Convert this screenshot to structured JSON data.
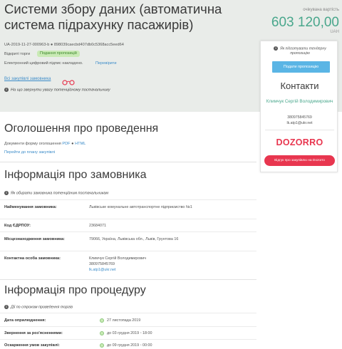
{
  "header": {
    "title": "Системи збору даних (автоматична система підрахунку пасажирів)",
    "price_label": "очікувана вартість",
    "price": "603 120,00",
    "currency": "UAH",
    "tender_id": "UA-2019-11-27-000963-b ● 898039caecbd407db0c5368acc5eed64",
    "tender_type": "Відкриті торги",
    "status_badge": "Подання пропозицій",
    "signature_text": "Електронний цифровий підпис накладено.",
    "signature_link": "Перевірити",
    "all_procurements_link": "Всі закупівлі замовника",
    "attention_hint": "На що звернути увагу потенційному постачальнику"
  },
  "panel": {
    "hint": "Як підготувати тендерну пропозицію",
    "offer_button": "Подати пропозицію",
    "contacts_title": "Контакти",
    "contact_name": "Климчук Сергій Володимирович",
    "phone": "380975845769",
    "email": "lk.atp1@ukr.net",
    "dozorro_logo": "DOZORRO",
    "review_button": "Відгук про закупівлю на Dozorro"
  },
  "announcement": {
    "title": "Оголошення про проведення",
    "docs_prefix": "Документи форму оголошення",
    "pdf": "PDF",
    "sep": "●",
    "html": "HTML",
    "plan_link": "Перейти до плану закупівлі"
  },
  "customer": {
    "title": "Інформація про замовника",
    "hint": "Як обирати замовника потенційним постачальникам",
    "rows": [
      {
        "label": "Найменування замовника:",
        "value": "Львівське комунальне автотранспортне підприємство №1"
      },
      {
        "label": "Код ЄДРПОУ:",
        "value": "23684071"
      },
      {
        "label": "Місцезнаходження замовника:",
        "value": "79066, Україна, Львівська обл., Львів, Грунтова 16"
      },
      {
        "label": "Контактна особа замовника:",
        "value": "Климчук Сергій Володимирович",
        "phone": "380975845769",
        "email": "lk.atp1@ukr.net"
      }
    ]
  },
  "procedure": {
    "title": "Інформація про процедуру",
    "hint": "Дії по строкам проведення торгів",
    "rows": [
      {
        "label": "Дата оприлюднення:",
        "prefix": "",
        "value": "27 листопада 2019"
      },
      {
        "label": "Звернення за роз'ясненнями:",
        "prefix": "до",
        "value": "03 грудня 2019 ◦ 18:00"
      },
      {
        "label": "Оскарження умов закупівлі:",
        "prefix": "до",
        "value": "09 грудня 2019 ◦ 00:00"
      }
    ]
  },
  "colors": {
    "accent_green": "#49a78c",
    "link_blue": "#3c8cc9",
    "dozorro_red": "#e8364f",
    "offer_button_blue": "#5ab5e5"
  }
}
